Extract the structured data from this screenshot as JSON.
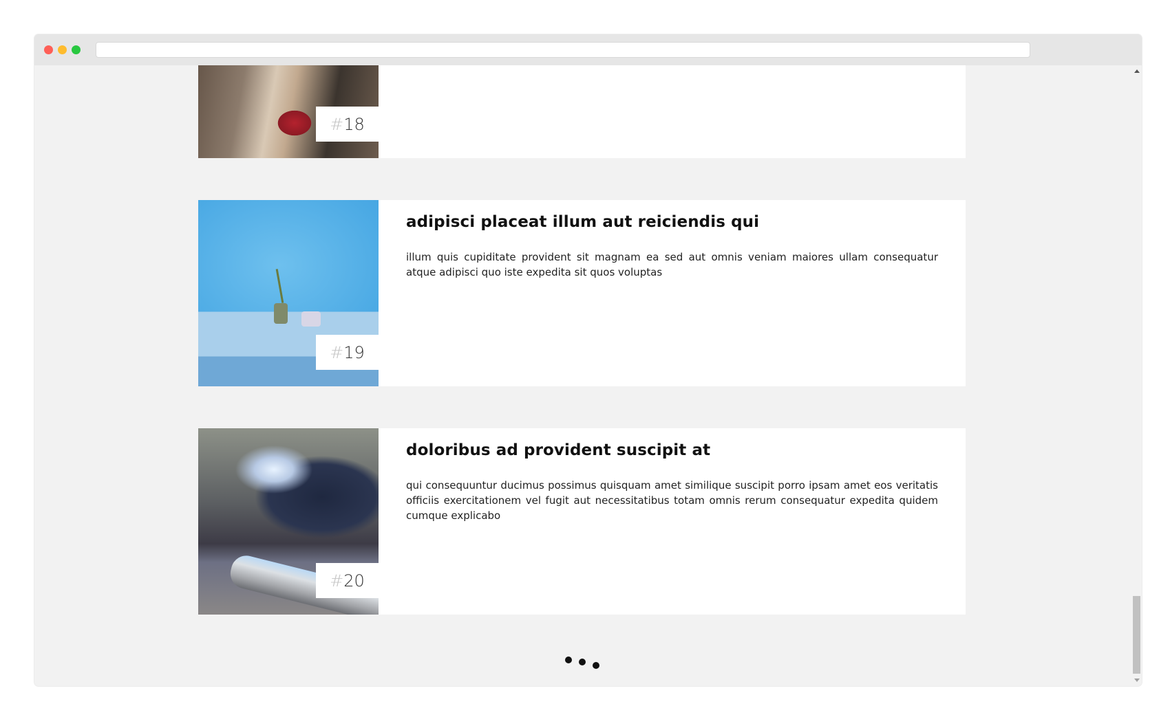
{
  "browser": {
    "address": ""
  },
  "cards": [
    {
      "number_prefix": "#",
      "number": "18",
      "title": "",
      "text": "",
      "image": "guitar-player-photo"
    },
    {
      "number_prefix": "#",
      "number": "19",
      "title": "adipisci placeat illum aut reiciendis qui",
      "text": "illum quis cupiditate provident sit magnam ea sed aut omnis veniam maiores ullam consequatur atque adipisci quo iste expedita sit quos voluptas",
      "image": "plant-on-blue-table-photo"
    },
    {
      "number_prefix": "#",
      "number": "20",
      "title": "doloribus ad provident suscipit at",
      "text": "qui consequuntur ducimus possimus quisquam amet similique suscipit porro ipsam amet eos veritatis officiis exercitationem vel fugit aut necessitatibus totam omnis rerum consequatur expedita quidem cumque explicabo",
      "image": "smartphone-closeup-photo"
    }
  ],
  "loader": {
    "icon": "loading-dots-icon"
  },
  "colors": {
    "page_background": "#f2f2f2",
    "card_background": "#ffffff",
    "title_text": "#111111",
    "badge_hash": "#c4c4c4"
  }
}
